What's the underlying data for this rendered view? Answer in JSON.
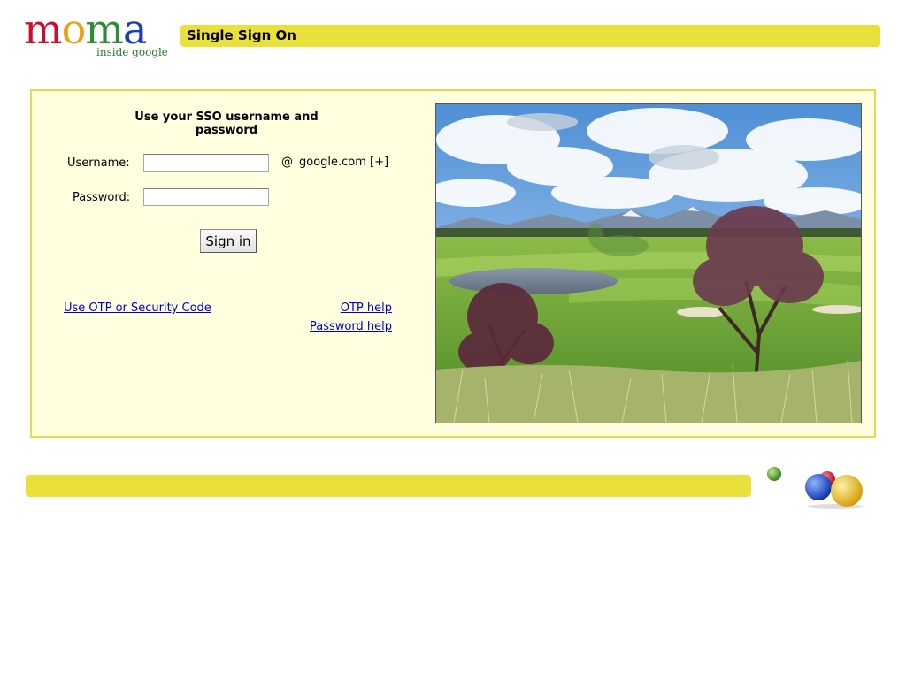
{
  "logo": {
    "letters": [
      {
        "char": "m",
        "color": "#c8102e"
      },
      {
        "char": "o",
        "color": "#e8a317"
      },
      {
        "char": "m",
        "color": "#2e8b2e"
      },
      {
        "char": "a",
        "color": "#1a3cb8"
      }
    ],
    "tagline": "inside google"
  },
  "header": {
    "title": "Single Sign On"
  },
  "form": {
    "heading": "Use your SSO username and password",
    "username_label": "Username:",
    "username_value": "",
    "at_symbol": "@",
    "domain": "google.com",
    "domain_expand": "[+]",
    "password_label": "Password:",
    "password_value": "",
    "signin_label": "Sign in"
  },
  "links": {
    "otp_code": "Use OTP or Security Code",
    "otp_help": "OTP help",
    "password_help": "Password help"
  },
  "images": {
    "landscape_photo": "golf-course-landscape",
    "decoration": "colored-balls-icon"
  },
  "colors": {
    "bar_yellow": "#e9e03a",
    "panel_border": "#e0dc50",
    "panel_background": "#ffffdf",
    "link_blue": "#0000cc"
  }
}
